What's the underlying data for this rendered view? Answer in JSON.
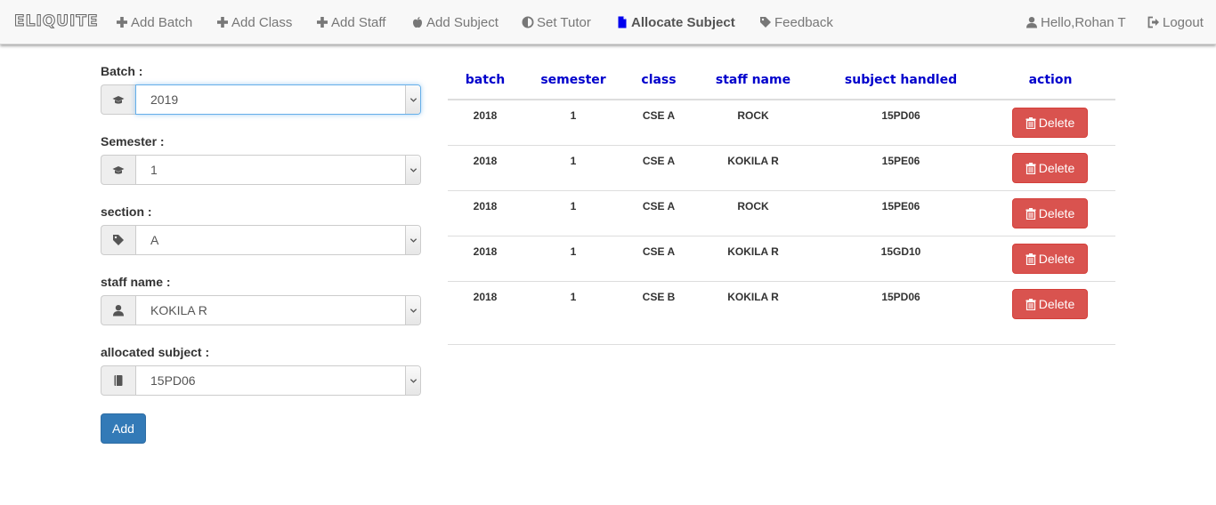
{
  "navbar": {
    "brand": "ELIQUITE",
    "items": [
      {
        "label": "Add Batch",
        "icon": "plus-icon"
      },
      {
        "label": "Add Class",
        "icon": "plus-icon"
      },
      {
        "label": "Add Staff",
        "icon": "plus-icon"
      },
      {
        "label": "Add Subject",
        "icon": "apple-icon"
      },
      {
        "label": "Set Tutor",
        "icon": "adjust-icon"
      },
      {
        "label": "Allocate Subject",
        "icon": "file-icon",
        "active": true
      },
      {
        "label": "Feedback",
        "icon": "tag-icon"
      }
    ],
    "user": {
      "label": "Hello,Rohan T",
      "icon": "user-icon"
    },
    "logout": {
      "label": "Logout",
      "icon": "logout-icon"
    }
  },
  "form": {
    "batch": {
      "label": "Batch :",
      "value": "2019",
      "icon": "graduation-cap-icon"
    },
    "semester": {
      "label": "Semester :",
      "value": "1",
      "icon": "graduation-cap-icon"
    },
    "section": {
      "label": "section :",
      "value": "A",
      "icon": "tag-icon"
    },
    "staff": {
      "label": "staff name :",
      "value": "KOKILA R",
      "icon": "user-icon"
    },
    "subject": {
      "label": "allocated subject :",
      "value": "15PD06",
      "icon": "book-icon"
    },
    "add_label": "Add"
  },
  "table": {
    "headers": [
      "batch",
      "semester",
      "class",
      "staff name",
      "subject handled",
      "action"
    ],
    "delete_label": "Delete",
    "rows": [
      [
        "2018",
        "1",
        "CSE A",
        "ROCK",
        "15PD06"
      ],
      [
        "2018",
        "1",
        "CSE A",
        "KOKILA R",
        "15PE06"
      ],
      [
        "2018",
        "1",
        "CSE A",
        "ROCK",
        "15PE06"
      ],
      [
        "2018",
        "1",
        "CSE A",
        "KOKILA R",
        "15GD10"
      ],
      [
        "2018",
        "1",
        "CSE B",
        "KOKILA R",
        "15PD06"
      ]
    ]
  },
  "colors": {
    "header_text": "#0000cc",
    "active_icon": "#0000ee",
    "add_button": "#337ab7",
    "delete_button": "#d9534f"
  }
}
